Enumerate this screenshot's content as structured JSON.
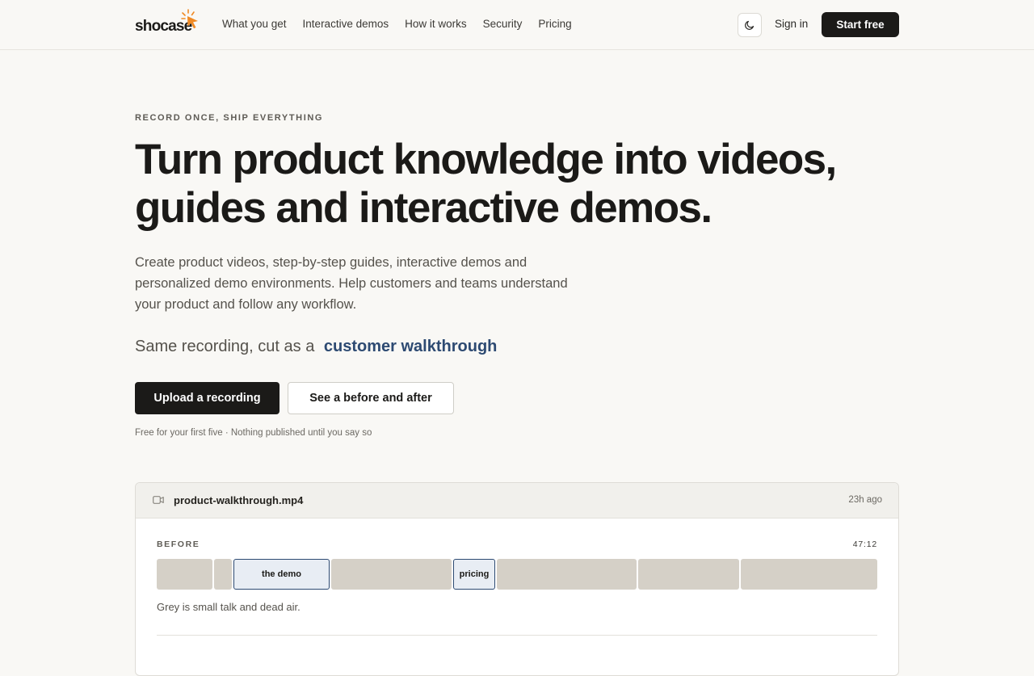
{
  "nav": {
    "logo_text": "shocase",
    "links": [
      "What you get",
      "Interactive demos",
      "How it works",
      "Security",
      "Pricing"
    ],
    "sign_in": "Sign in",
    "start_free": "Start free",
    "theme_icon": "moon-icon"
  },
  "hero": {
    "eyebrow": "RECORD ONCE, SHIP EVERYTHING",
    "headline_line1": "Turn product knowledge into videos,",
    "headline_line2": "guides and interactive demos.",
    "subhead": "Create product videos, step-by-step guides, interactive demos and personalized demo environments. Help customers and teams understand your product and follow any workflow.",
    "tagline_prefix": "Same recording, cut as a",
    "tagline_accent": "customer walkthrough",
    "cta_primary": "Upload a recording",
    "cta_secondary": "See a before and after",
    "fineprint": "Free for your first five · Nothing published until you say so"
  },
  "card": {
    "file_icon": "video-camera-icon",
    "file_name": "product-walkthrough.mp4",
    "time_ago": "23h ago",
    "before_label": "BEFORE",
    "duration": "47:12",
    "segments": [
      "the demo",
      "pricing"
    ],
    "legend": "Grey is small talk and dead air."
  },
  "colors": {
    "background": "#f9f8f5",
    "ink": "#1b1a18",
    "accent": "#2d4a72",
    "logo_orange": "#f08a24",
    "segment_grey": "#d5d0c7"
  }
}
